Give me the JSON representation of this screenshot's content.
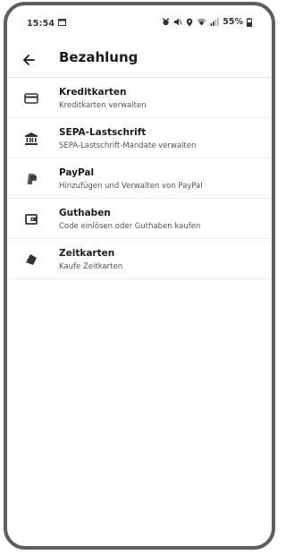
{
  "status_bar": {
    "time": "15:54",
    "battery": "55%"
  },
  "header": {
    "title": "Bezahlung"
  },
  "items": [
    {
      "title": "Kreditkarten",
      "subtitle": "Kreditkarten verwalten",
      "icon": "credit-card-icon"
    },
    {
      "title": "SEPA-Lastschrift",
      "subtitle": "SEPA-Lastschrift-Mandate verwalten",
      "icon": "bank-icon"
    },
    {
      "title": "PayPal",
      "subtitle": "Hinzufügen und Verwalten von PayPal",
      "icon": "paypal-icon"
    },
    {
      "title": "Guthaben",
      "subtitle": "Code einlösen oder Guthaben kaufen",
      "icon": "wallet-icon"
    },
    {
      "title": "Zeitkarten",
      "subtitle": "Kaufe Zeitkarten",
      "icon": "ticket-cards-icon"
    }
  ]
}
